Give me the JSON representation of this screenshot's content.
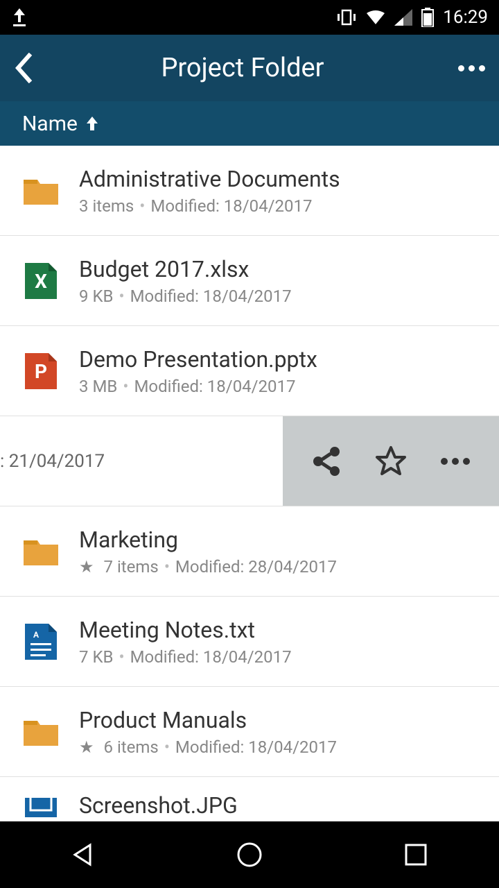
{
  "status": {
    "time": "16:29"
  },
  "header": {
    "title": "Project Folder"
  },
  "sort": {
    "label": "Name"
  },
  "items": [
    {
      "type": "folder",
      "title": "Administrative Documents",
      "meta1": "3 items",
      "meta2": "Modified: 18/04/2017",
      "favorite": false
    },
    {
      "type": "xlsx",
      "title": "Budget 2017.xlsx",
      "meta1": "9 KB",
      "meta2": "Modified: 18/04/2017",
      "favorite": false
    },
    {
      "type": "pptx",
      "title": "Demo Presentation.pptx",
      "meta1": "3 MB",
      "meta2": "Modified: 18/04/2017",
      "favorite": false
    }
  ],
  "selected": {
    "meta_fragment": ": 21/04/2017"
  },
  "items2": [
    {
      "type": "folder",
      "title": "Marketing",
      "meta1": "7 items",
      "meta2": "Modified: 28/04/2017",
      "favorite": true
    },
    {
      "type": "txt",
      "title": "Meeting Notes.txt",
      "meta1": "7 KB",
      "meta2": "Modified: 18/04/2017",
      "favorite": false
    },
    {
      "type": "folder",
      "title": "Product Manuals",
      "meta1": "6 items",
      "meta2": "Modified: 18/04/2017",
      "favorite": true
    },
    {
      "type": "img",
      "title": "Screenshot.JPG",
      "meta1": "",
      "meta2": "",
      "favorite": false
    }
  ]
}
